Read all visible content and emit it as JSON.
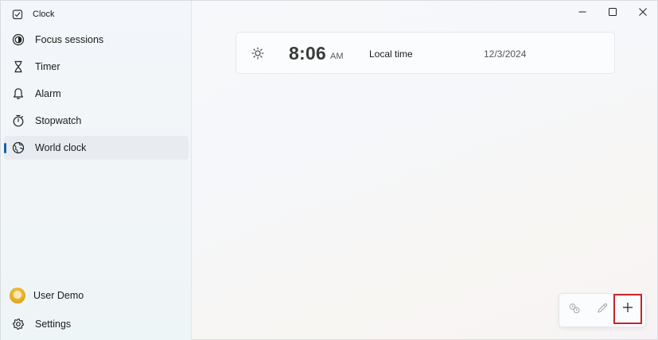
{
  "app": {
    "title": "Clock"
  },
  "sidebar": {
    "items": [
      {
        "label": "Focus sessions",
        "icon": "focus-icon"
      },
      {
        "label": "Timer",
        "icon": "hourglass-icon"
      },
      {
        "label": "Alarm",
        "icon": "bell-icon"
      },
      {
        "label": "Stopwatch",
        "icon": "stopwatch-icon"
      },
      {
        "label": "World clock",
        "icon": "globe-icon",
        "active": true
      }
    ],
    "user": {
      "name": "User Demo",
      "icon": "avatar"
    },
    "settings": {
      "label": "Settings",
      "icon": "gear-icon"
    }
  },
  "window_controls": [
    "minimize-icon",
    "maximize-icon",
    "close-icon"
  ],
  "local_clock": {
    "icon": "sun-icon",
    "time": "8:06",
    "ampm": "AM",
    "label": "Local time",
    "date": "12/3/2024"
  },
  "actions": [
    "compare-icon",
    "edit-icon",
    "add-icon"
  ],
  "colors": {
    "accent": "#1a5fa8",
    "highlight_box": "#c4262e"
  }
}
